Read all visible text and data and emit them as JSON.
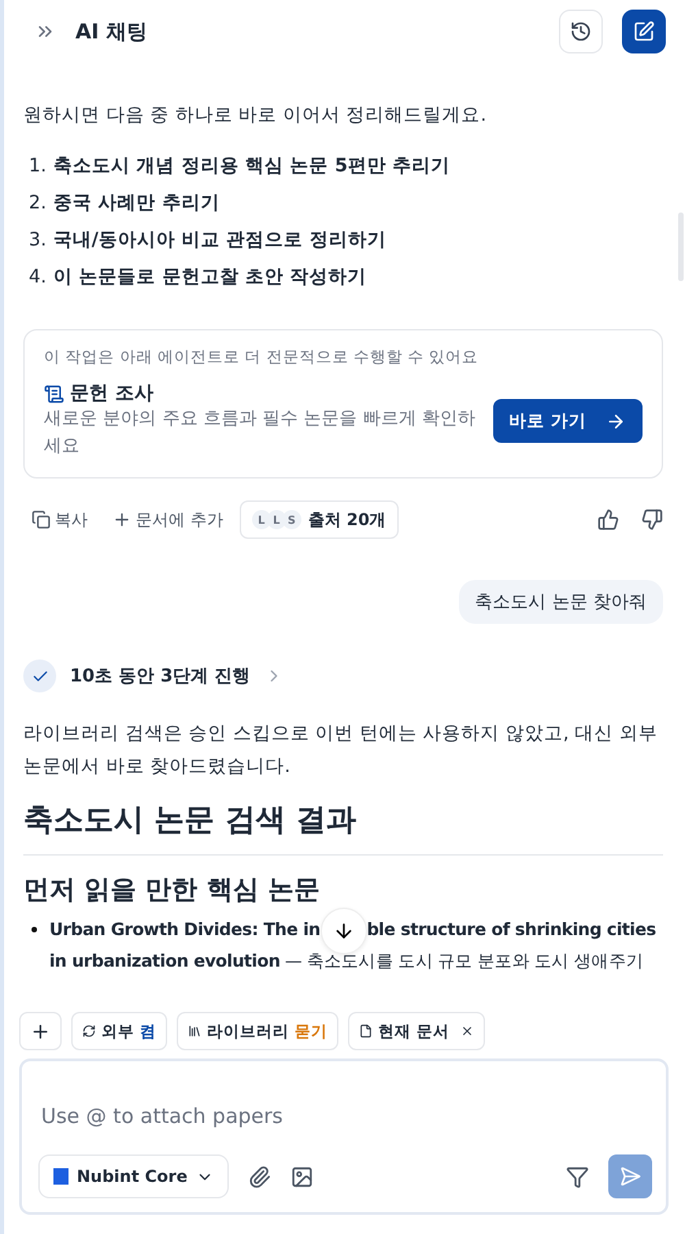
{
  "header": {
    "title": "AI 채팅"
  },
  "intro": "원하시면 다음 중 하나로 바로 이어서 정리해드릴게요.",
  "options": [
    {
      "number": "1.",
      "text": "축소도시 개념 정리용 핵심 논문 5편만 추리기"
    },
    {
      "number": "2.",
      "text": "중국 사례만 추리기"
    },
    {
      "number": "3.",
      "text": "국내/동아시아 비교 관점으로 정리하기"
    },
    {
      "number": "4.",
      "text": "이 논문들로 문헌고찰 초안 작성하기"
    }
  ],
  "agent_card": {
    "hint": "이 작업은 아래 에이전트로 더 전문적으로 수행할 수 있어요",
    "title": "문헌 조사",
    "description": "새로운 분야의 주요 흐름과 필수 논문을 빠르게 확인하세요",
    "button": "바로 가기"
  },
  "actions": {
    "copy": "복사",
    "add": "문서에 추가",
    "source_avatars": [
      "L",
      "L",
      "S"
    ],
    "sources": "출처 20개"
  },
  "user_message": "축소도시 논문 찾아줘",
  "steps": {
    "label": "10초 동안 3단계 진행",
    "done": true
  },
  "answer": "라이브러리 검색은 승인 스킵으로 이번 턴에는 사용하지 않았고, 대신 외부 논문에서 바로 찾아드렸습니다.",
  "heading": "축소도시 논문 검색 결과",
  "subheading": "먼저 읽을 만한 핵심 논문",
  "paper": {
    "before": "**Urban Growth Divides: The in**",
    "after": "**ble structure of shrinking cities in urbanization evolution** — 축소도시를 도시 규모 분포와 도시 생애주기"
  },
  "chips": [
    {
      "kind": "toggle",
      "label": "외부",
      "state": "켬",
      "color": "#0b4aa8"
    },
    {
      "kind": "toggle",
      "label": "라이브러리",
      "state": "묻기",
      "color": "#d9770b"
    },
    {
      "kind": "document",
      "label": "현재 문서"
    }
  ],
  "composer": {
    "placeholder": "Use @ to attach papers",
    "model": "Nubint Core",
    "send_disabled": true
  }
}
